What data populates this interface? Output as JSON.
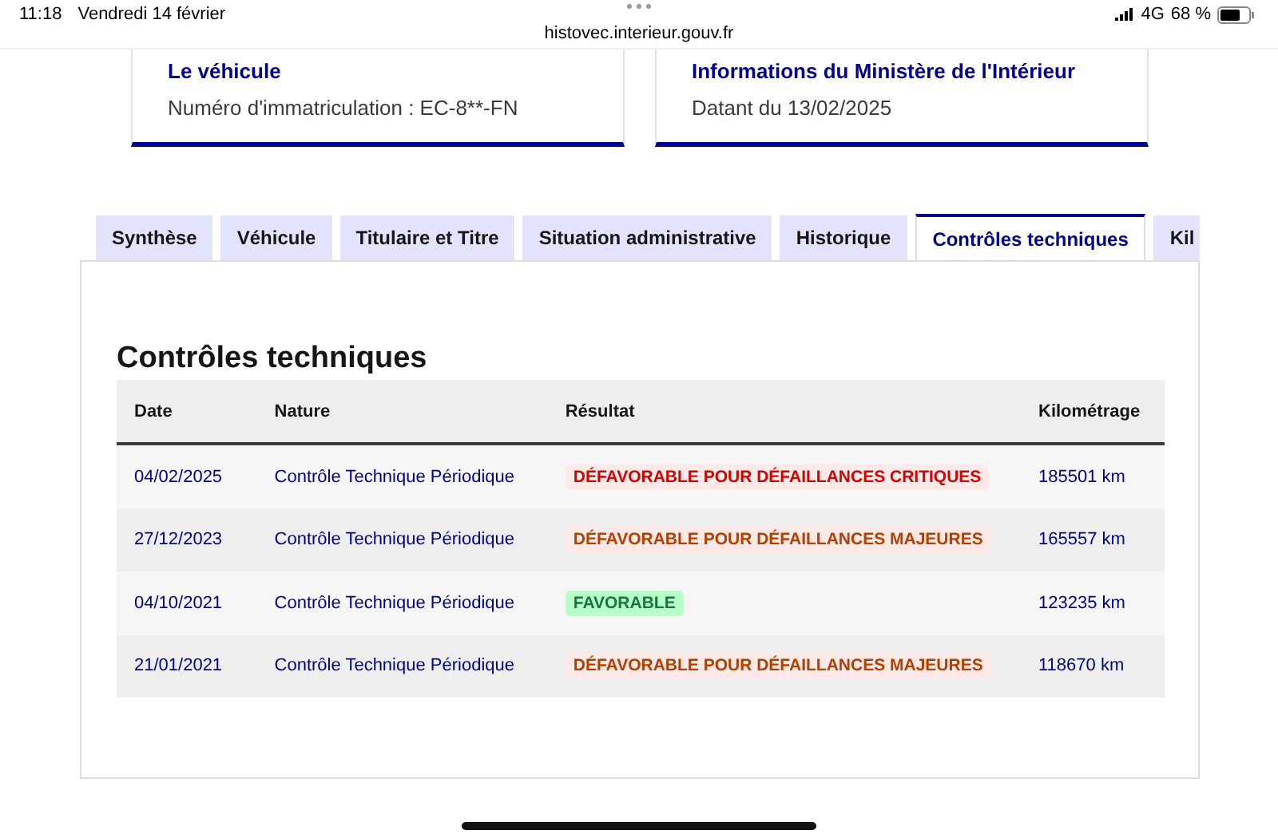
{
  "status_bar": {
    "time": "11:18",
    "date": "Vendredi 14 février",
    "url": "histovec.interieur.gouv.fr",
    "network": "4G",
    "battery": "68 %"
  },
  "cards": [
    {
      "title": "Le véhicule",
      "text": "Numéro d'immatriculation : EC-8**-FN"
    },
    {
      "title": "Informations du Ministère de l'Intérieur",
      "text": "Datant du 13/02/2025"
    }
  ],
  "tabs": [
    {
      "label": "Synthèse",
      "selected": false
    },
    {
      "label": "Véhicule",
      "selected": false
    },
    {
      "label": "Titulaire et Titre",
      "selected": false
    },
    {
      "label": "Situation administrative",
      "selected": false
    },
    {
      "label": "Historique",
      "selected": false
    },
    {
      "label": "Contrôles techniques",
      "selected": true
    },
    {
      "label": "Kil",
      "selected": false
    }
  ],
  "section_title": "Contrôles techniques",
  "table": {
    "columns": [
      "Date",
      "Nature",
      "Résultat",
      "Kilométrage"
    ],
    "rows": [
      {
        "date": "04/02/2025",
        "nature": "Contrôle Technique Périodique",
        "result": {
          "text": "DÉFAVORABLE POUR DÉFAILLANCES CRITIQUES",
          "kind": "critical"
        },
        "mileage": "185501 km"
      },
      {
        "date": "27/12/2023",
        "nature": "Contrôle Technique Périodique",
        "result": {
          "text": "DÉFAVORABLE POUR DÉFAILLANCES MAJEURES",
          "kind": "major"
        },
        "mileage": "165557 km"
      },
      {
        "date": "04/10/2021",
        "nature": "Contrôle Technique Périodique",
        "result": {
          "text": "FAVORABLE",
          "kind": "favorable"
        },
        "mileage": "123235 km"
      },
      {
        "date": "21/01/2021",
        "nature": "Contrôle Technique Périodique",
        "result": {
          "text": "DÉFAVORABLE POUR DÉFAILLANCES MAJEURES",
          "kind": "major"
        },
        "mileage": "118670 km"
      }
    ]
  }
}
